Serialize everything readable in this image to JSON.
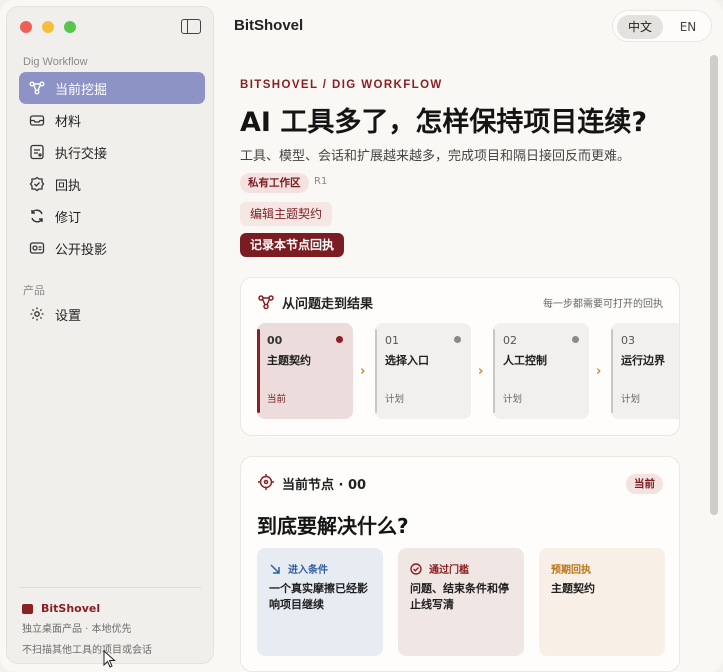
{
  "app": {
    "title": "BitShovel"
  },
  "language": {
    "zh": "中文",
    "en": "EN"
  },
  "sidebar": {
    "section_workflow": "Dig Workflow",
    "items": [
      {
        "label": "当前挖掘",
        "icon": "graph-nodes-icon"
      },
      {
        "label": "材料",
        "icon": "inbox-tray-icon"
      },
      {
        "label": "执行交接",
        "icon": "handoff-doc-icon"
      },
      {
        "label": "回执",
        "icon": "check-circle-icon"
      },
      {
        "label": "修订",
        "icon": "refresh-icon"
      },
      {
        "label": "公开投影",
        "icon": "projection-card-icon"
      }
    ],
    "section_product": "产品",
    "settings_label": "设置",
    "footer": {
      "brand": "BitShovel",
      "line1": "独立桌面产品 · 本地优先",
      "line2": "不扫描其他工具的项目或会话"
    }
  },
  "main": {
    "kicker": "BITSHOVEL / DIG WORKFLOW",
    "headline": "AI 工具多了，怎样保持项目连续?",
    "subline": "工具、模型、会话和扩展越来越多，完成项目和隔日接回反而更难。",
    "workspace_chip": "私有工作区",
    "revision": "R1",
    "edit_button": "编辑主题契约",
    "record_button": "记录本节点回执"
  },
  "flow_card": {
    "title": "从问题走到结果",
    "hint": "每一步都需要可打开的回执",
    "steps": [
      {
        "num": "00",
        "name": "主题契约",
        "state": "当前"
      },
      {
        "num": "01",
        "name": "选择入口",
        "state": "计划"
      },
      {
        "num": "02",
        "name": "人工控制",
        "state": "计划"
      },
      {
        "num": "03",
        "name": "运行边界",
        "state": "计划"
      }
    ]
  },
  "node_card": {
    "title": "当前节点 · 00",
    "badge": "当前",
    "question": "到底要解决什么?",
    "tiles": [
      {
        "title": "进入条件",
        "body": "一个真实摩擦已经影响项目继续",
        "color": "#2f5fa0"
      },
      {
        "title": "通过门槛",
        "body": "问题、结束条件和停止线写清",
        "color": "#8a1f24"
      },
      {
        "title": "预期回执",
        "body": "主题契约",
        "color": "#b9741b"
      }
    ]
  },
  "colors": {
    "accent": "#8a1f24",
    "nav_active": "#8d93c4"
  }
}
